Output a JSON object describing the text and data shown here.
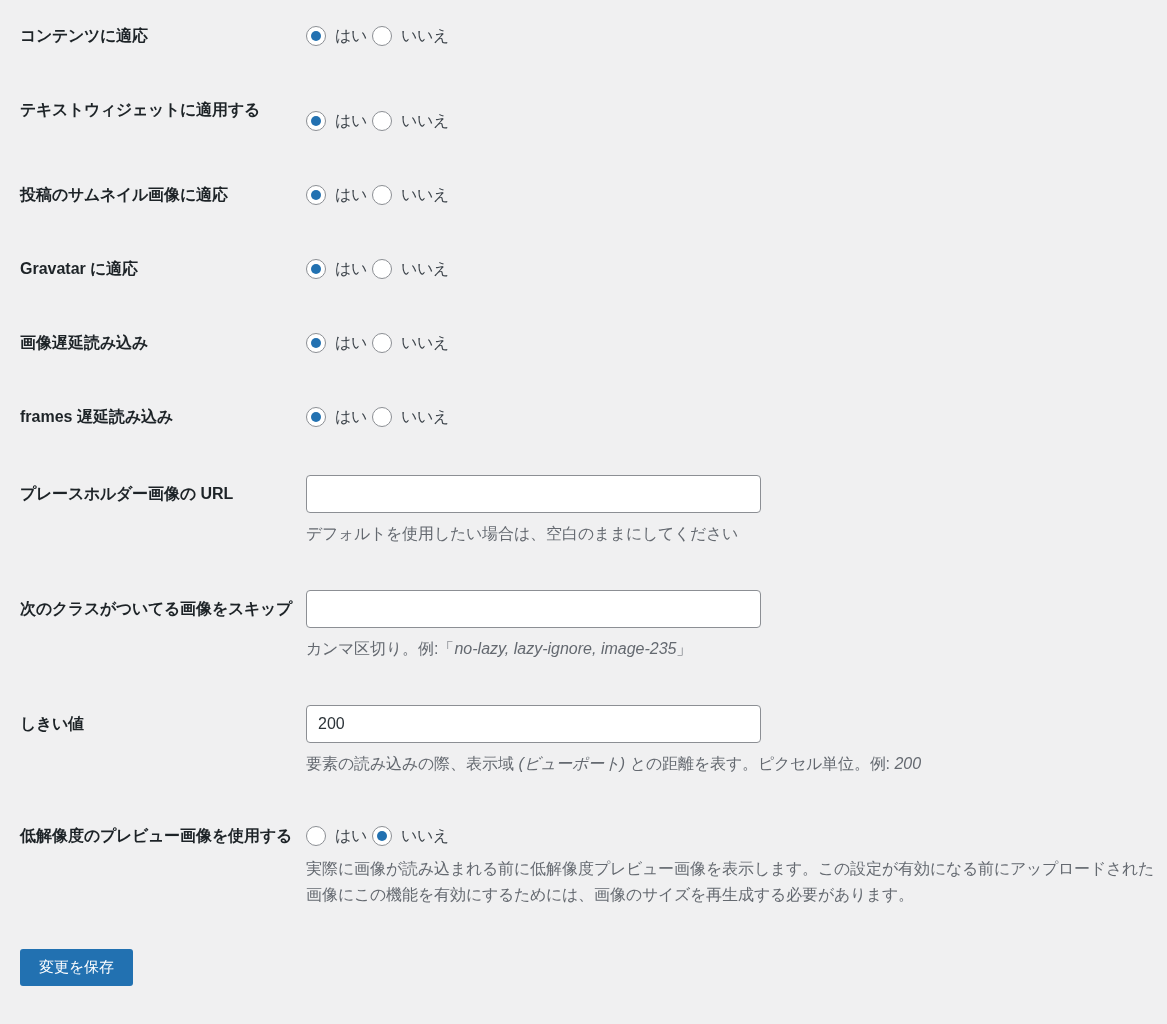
{
  "settings": [
    {
      "kind": "radio",
      "label": "コンテンツに適応",
      "options": [
        {
          "label": "はい",
          "selected": true
        },
        {
          "label": "いいえ",
          "selected": false
        }
      ]
    },
    {
      "kind": "radio",
      "label": "テキストウィジェットに適用する",
      "options": [
        {
          "label": "はい",
          "selected": true
        },
        {
          "label": "いいえ",
          "selected": false
        }
      ]
    },
    {
      "kind": "radio",
      "label": "投稿のサムネイル画像に適応",
      "options": [
        {
          "label": "はい",
          "selected": true
        },
        {
          "label": "いいえ",
          "selected": false
        }
      ]
    },
    {
      "kind": "radio",
      "label": "Gravatar に適応",
      "options": [
        {
          "label": "はい",
          "selected": true
        },
        {
          "label": "いいえ",
          "selected": false
        }
      ]
    },
    {
      "kind": "radio",
      "label": "画像遅延読み込み",
      "options": [
        {
          "label": "はい",
          "selected": true
        },
        {
          "label": "いいえ",
          "selected": false
        }
      ]
    },
    {
      "kind": "radio",
      "label": "frames 遅延読み込み",
      "options": [
        {
          "label": "はい",
          "selected": true
        },
        {
          "label": "いいえ",
          "selected": false
        }
      ]
    },
    {
      "kind": "text",
      "label": "プレースホルダー画像の URL",
      "description": "デフォルトを使用したい場合は、空白のままにしてください"
    },
    {
      "kind": "text",
      "label": "次のクラスがついてる画像をスキップ",
      "description": "カンマ区切り。例:「*no-lazy, lazy-ignore, image-235*」"
    },
    {
      "kind": "text",
      "label": "しきい値",
      "value": "200",
      "description": "要素の読み込みの際、表示域 *(ビューポート)* との距離を表す。ピクセル単位。例: *200*"
    },
    {
      "kind": "radio",
      "label": "低解像度のプレビュー画像を使用する",
      "options": [
        {
          "label": "はい",
          "selected": false
        },
        {
          "label": "いいえ",
          "selected": true
        }
      ],
      "description": "実際に画像が読み込まれる前に低解像度プレビュー画像を表示します。この設定が有効になる前にアップロードされた画像にこの機能を有効にするためには、画像のサイズを再生成する必要があります。"
    }
  ],
  "save_button": "変更を保存"
}
